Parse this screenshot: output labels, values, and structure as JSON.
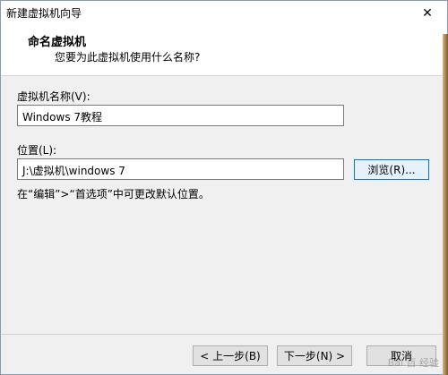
{
  "window": {
    "title": "新建虚拟机向导",
    "close_glyph": "✕"
  },
  "header": {
    "title": "命名虚拟机",
    "subtitle": "您要为此虚拟机使用什么名称?"
  },
  "name_field": {
    "label": "虚拟机名称(V):",
    "value": "Windows 7教程"
  },
  "location_field": {
    "label": "位置(L):",
    "value": "J:\\虚拟机\\windows 7",
    "browse_label": "浏览(R)..."
  },
  "hint": "在“编辑”>“首选项”中可更改默认位置。",
  "buttons": {
    "back": "< 上一步(B)",
    "next": "下一步(N) >",
    "cancel": "取消"
  },
  "watermark": "Bai 百 经验"
}
